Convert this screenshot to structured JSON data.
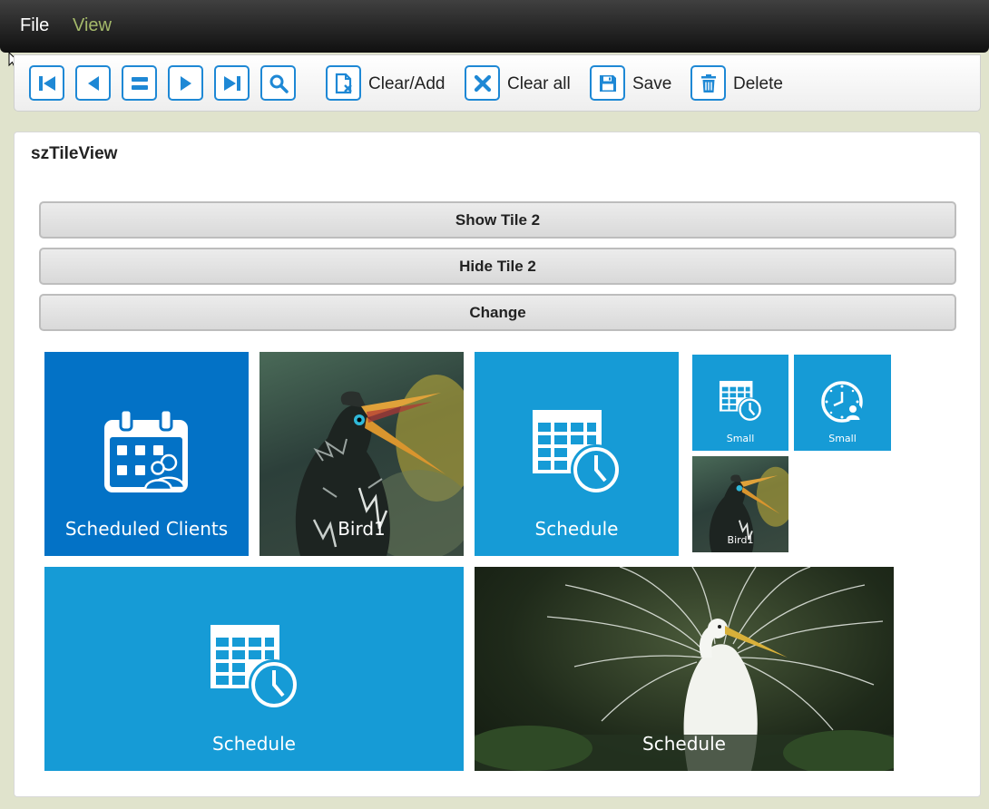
{
  "menu": {
    "file": "File",
    "view": "View"
  },
  "toolbar": {
    "clear_add": "Clear/Add",
    "clear_all": "Clear all",
    "save": "Save",
    "delete": "Delete"
  },
  "panel": {
    "title": "szTileView"
  },
  "buttons": {
    "show_tile": "Show Tile 2",
    "hide_tile": "Hide Tile 2",
    "change": "Change"
  },
  "tiles": [
    {
      "label": "Scheduled Clients",
      "icon": "calendar-clients-icon",
      "color": "#0372c6"
    },
    {
      "label": "Bird1",
      "icon": "bird-photo"
    },
    {
      "label": "Schedule",
      "icon": "schedule-icon",
      "color": "#169bd6"
    },
    {
      "label": "Small",
      "icon": "schedule-icon",
      "color": "#169bd6"
    },
    {
      "label": "Small",
      "icon": "clock-user-icon",
      "color": "#169bd6"
    },
    {
      "label": "Bird1",
      "icon": "bird-photo"
    },
    {
      "label": "Schedule",
      "icon": "schedule-icon",
      "color": "#169bd6"
    },
    {
      "label": "Schedule",
      "icon": "egret-photo"
    }
  ],
  "colors": {
    "accent": "#1e88d5",
    "tile_dark": "#0372c6",
    "tile_light": "#169bd6"
  }
}
